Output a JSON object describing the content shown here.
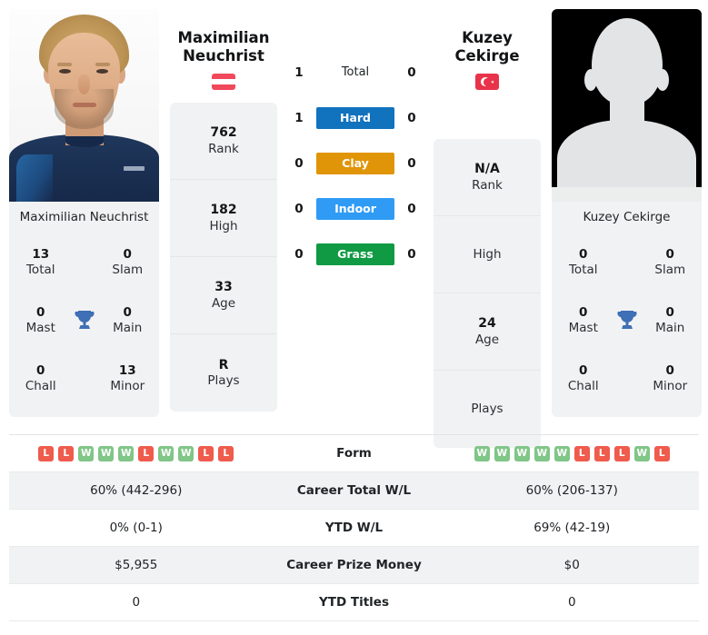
{
  "players": {
    "left": {
      "name_line1": "Maximilian",
      "name_line2": "Neuchrist",
      "full_name": "Maximilian Neuchrist",
      "photo_caption": "Maximilian Neuchrist",
      "country": "Austria",
      "flag_icon": "flag-austria-icon",
      "info": [
        {
          "value": "762",
          "label": "Rank"
        },
        {
          "value": "182",
          "label": "High"
        },
        {
          "value": "33",
          "label": "Age"
        },
        {
          "value": "R",
          "label": "Plays"
        }
      ],
      "titles": [
        {
          "value": "13",
          "label": "Total"
        },
        {
          "value": "0",
          "label": "Slam"
        },
        {
          "value": "0",
          "label": "Mast"
        },
        {
          "value": "0",
          "label": "Main"
        },
        {
          "value": "0",
          "label": "Chall"
        },
        {
          "value": "13",
          "label": "Minor"
        }
      ],
      "form": [
        "L",
        "L",
        "W",
        "W",
        "W",
        "L",
        "W",
        "W",
        "L",
        "L"
      ],
      "career_total_wl": "60% (442-296)",
      "ytd_wl": "0% (0-1)",
      "career_prize_money": "$5,955",
      "ytd_titles": "0"
    },
    "right": {
      "name_line1": "Kuzey",
      "name_line2": "Cekirge",
      "full_name": "Kuzey Cekirge",
      "photo_caption": "Kuzey Cekirge",
      "country": "Turkey",
      "flag_icon": "flag-turkey-icon",
      "info": [
        {
          "value": "N/A",
          "label": "Rank"
        },
        {
          "value": "",
          "label": "High"
        },
        {
          "value": "24",
          "label": "Age"
        },
        {
          "value": "",
          "label": "Plays"
        }
      ],
      "titles": [
        {
          "value": "0",
          "label": "Total"
        },
        {
          "value": "0",
          "label": "Slam"
        },
        {
          "value": "0",
          "label": "Mast"
        },
        {
          "value": "0",
          "label": "Main"
        },
        {
          "value": "0",
          "label": "Chall"
        },
        {
          "value": "0",
          "label": "Minor"
        }
      ],
      "form": [
        "W",
        "W",
        "W",
        "W",
        "W",
        "L",
        "L",
        "L",
        "W",
        "L"
      ],
      "career_total_wl": "60% (206-137)",
      "ytd_wl": "69% (42-19)",
      "career_prize_money": "$0",
      "ytd_titles": "0"
    }
  },
  "head_to_head": {
    "rows": [
      {
        "left": "1",
        "label": "Total",
        "right": "0",
        "color": ""
      },
      {
        "left": "1",
        "label": "Hard",
        "right": "0",
        "color": "#1172bd"
      },
      {
        "left": "0",
        "label": "Clay",
        "right": "0",
        "color": "#e09508"
      },
      {
        "left": "0",
        "label": "Indoor",
        "right": "0",
        "color": "#2f9bf5"
      },
      {
        "left": "0",
        "label": "Grass",
        "right": "0",
        "color": "#0f9a43"
      }
    ]
  },
  "table": {
    "rows": [
      {
        "key": "form",
        "label": "Form"
      },
      {
        "key": "career_total_wl",
        "label": "Career Total W/L"
      },
      {
        "key": "ytd_wl",
        "label": "YTD W/L"
      },
      {
        "key": "career_prize_money",
        "label": "Career Prize Money"
      },
      {
        "key": "ytd_titles",
        "label": "YTD Titles"
      }
    ]
  },
  "icons": {
    "trophy": "trophy-icon"
  },
  "colors": {
    "hard": "#1172bd",
    "clay": "#e09508",
    "indoor": "#2f9bf5",
    "grass": "#0f9a43",
    "win": "#80c687",
    "loss": "#ef5b4c",
    "card_bg": "#f1f2f3",
    "trophy": "#3f6fb5"
  }
}
